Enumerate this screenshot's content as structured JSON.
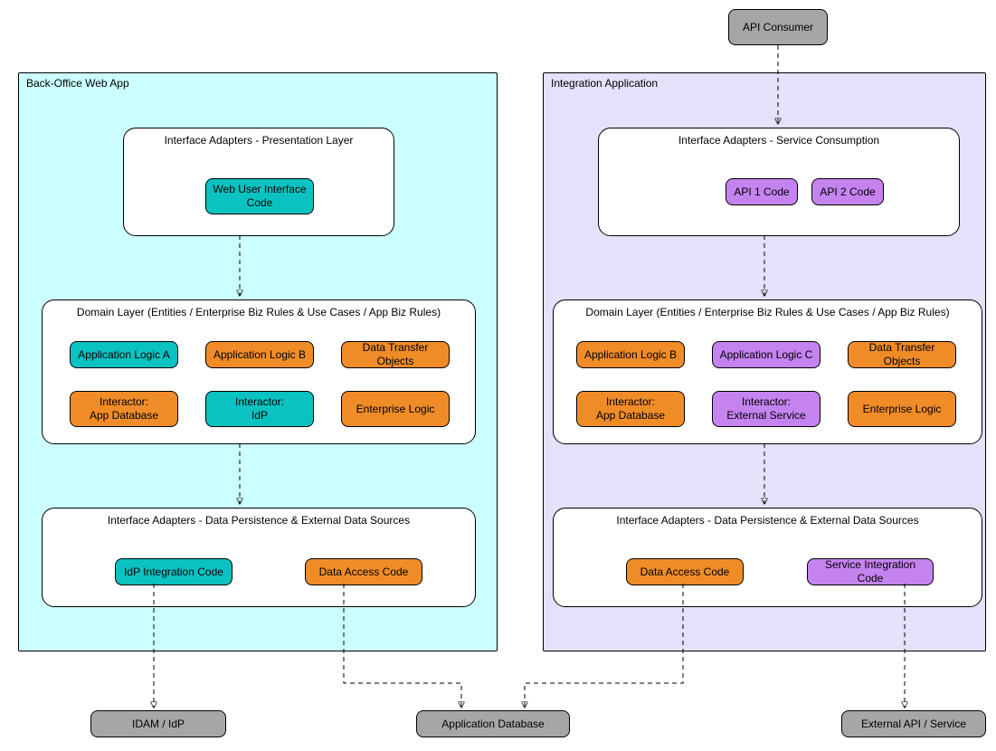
{
  "external": {
    "api_consumer": "API Consumer",
    "idam": "IDAM / IdP",
    "app_db": "Application Database",
    "ext_service": "External API / Service"
  },
  "left": {
    "title": "Back-Office Web App",
    "presentation": {
      "title": "Interface Adapters - Presentation Layer",
      "web_ui": "Web User Interface Code"
    },
    "domain": {
      "title": "Domain Layer (Entities / Enterprise Biz Rules & Use Cases / App Biz Rules)",
      "app_logic_a": "Application Logic A",
      "app_logic_b": "Application Logic B",
      "dto": "Data Transfer Objects",
      "interactor_db": "Interactor:\nApp Database",
      "interactor_idp": "Interactor:\nIdP",
      "enterprise": "Enterprise Logic"
    },
    "persistence": {
      "title": "Interface Adapters - Data Persistence & External Data Sources",
      "idp_code": "IdP Integration Code",
      "data_access": "Data Access Code"
    }
  },
  "right": {
    "title": "Integration Application",
    "service": {
      "title": "Interface Adapters - Service Consumption",
      "api1": "API 1 Code",
      "api2": "API 2 Code"
    },
    "domain": {
      "title": "Domain Layer (Entities / Enterprise Biz Rules & Use Cases / App Biz Rules)",
      "app_logic_b": "Application Logic B",
      "app_logic_c": "Application Logic C",
      "dto": "Data Transfer Objects",
      "interactor_db": "Interactor:\nApp Database",
      "interactor_ext": "Interactor:\nExternal Service",
      "enterprise": "Enterprise Logic"
    },
    "persistence": {
      "title": "Interface Adapters - Data Persistence & External Data Sources",
      "data_access": "Data Access Code",
      "svc_code": "Service Integration Code"
    }
  }
}
